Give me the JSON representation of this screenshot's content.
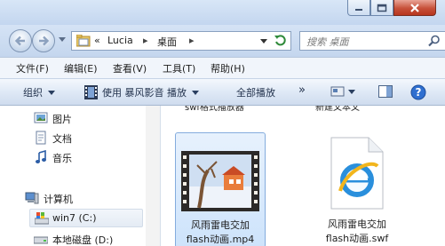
{
  "window": {
    "minimize_icon": "minimize-icon",
    "maximize_icon": "maximize-icon",
    "close_icon": "close-icon"
  },
  "address": {
    "prefix": "«",
    "crumbs": [
      "Lucia",
      "桌面"
    ],
    "separator": "▸"
  },
  "search": {
    "placeholder": "搜索 桌面"
  },
  "menu": [
    "文件(F)",
    "编辑(E)",
    "查看(V)",
    "工具(T)",
    "帮助(H)"
  ],
  "toolbar": {
    "organize": "组织",
    "open_with": "使用 暴风影音 播放",
    "play_all": "全部播放",
    "more": "»"
  },
  "nav_pane": {
    "items": [
      {
        "label": "图片",
        "icon": "pictures-icon"
      },
      {
        "label": "文档",
        "icon": "documents-icon"
      },
      {
        "label": "音乐",
        "icon": "music-icon"
      },
      {
        "label": "计算机",
        "icon": "computer-icon"
      },
      {
        "label": "win7 (C:)",
        "icon": "drive-c-icon"
      },
      {
        "label": "本地磁盘 (D:)",
        "icon": "drive-d-icon"
      }
    ]
  },
  "content": {
    "cut_labels": [
      "swf格式播放器",
      "新建文本文"
    ],
    "files": [
      {
        "name_line1": "风雨雷电交加",
        "name_line2": "flash动画.mp4",
        "icon": "video-file-icon",
        "selected": true
      },
      {
        "name_line1": "风雨雷电交加",
        "name_line2": "flash动画.swf",
        "icon": "ie-document-icon",
        "selected": false
      }
    ]
  },
  "colors": {
    "selection": "#cde3fb",
    "toolbar_text": "#1f2f4a"
  }
}
